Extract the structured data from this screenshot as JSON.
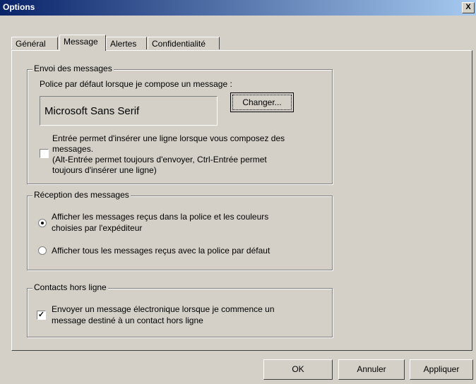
{
  "window": {
    "title": "Options",
    "close": "X"
  },
  "tabs": [
    {
      "label": "Général"
    },
    {
      "label": "Message",
      "active": true
    },
    {
      "label": "Alertes"
    },
    {
      "label": "Confidentialité"
    }
  ],
  "send": {
    "legend": "Envoi des messages",
    "font_label": "Police par défaut lorsque je compose un message :",
    "font_value": "Microsoft Sans Serif",
    "change_button": "Changer...",
    "enter_checkbox": {
      "checked": false,
      "line1": "Entrée permet d'insérer une ligne lorsque vous composez des",
      "line2": "messages.",
      "line3": "(Alt-Entrée permet toujours d'envoyer, Ctrl-Entrée permet",
      "line4": "toujours d'insérer une ligne)"
    }
  },
  "receive": {
    "legend": "Réception des messages",
    "option1_line1": "Afficher les messages reçus dans la police et les couleurs",
    "option1_line2": "choisies par l'expéditeur",
    "option2": "Afficher tous les messages reçus avec la police par défaut",
    "selected": 1
  },
  "offline": {
    "legend": "Contacts hors ligne",
    "checked": true,
    "line1": "Envoyer un message électronique lorsque je commence un",
    "line2": "message destiné à un contact hors ligne"
  },
  "buttons": {
    "ok": "OK",
    "cancel": "Annuler",
    "apply": "Appliquer"
  }
}
